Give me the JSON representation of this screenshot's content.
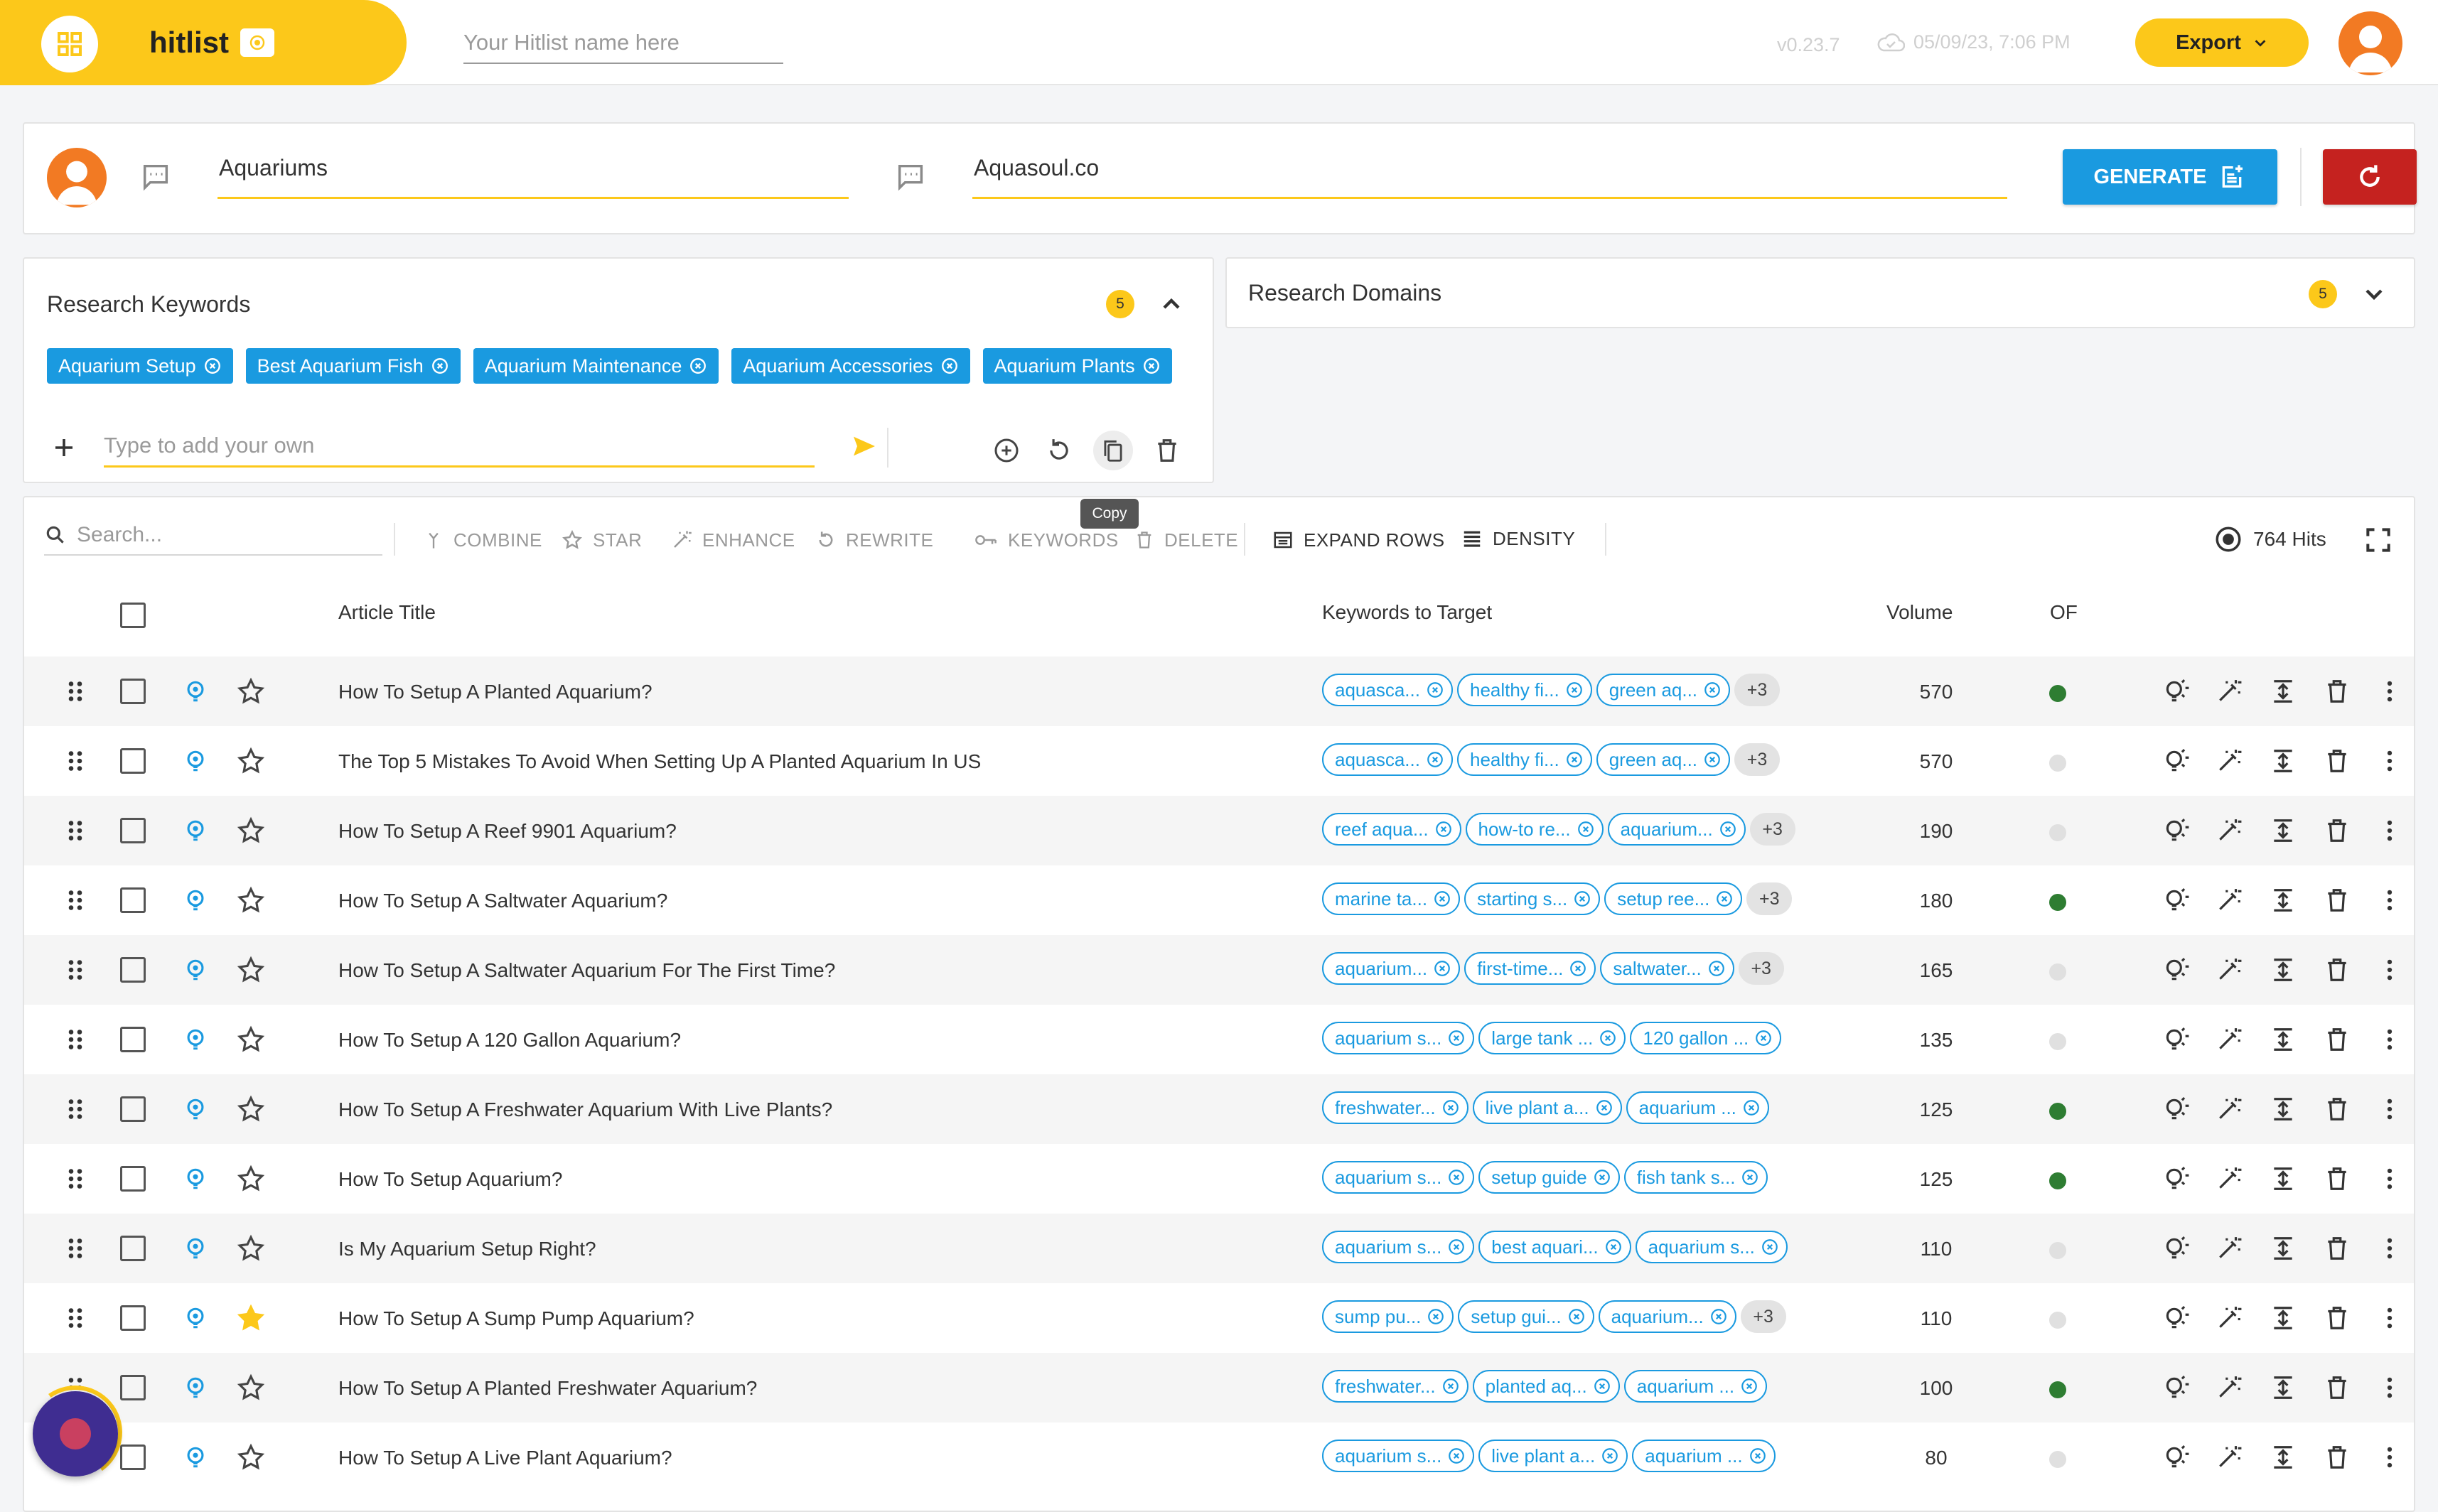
{
  "header": {
    "app_name": "hitlist",
    "name_placeholder": "Your Hitlist name here",
    "version": "v0.23.7",
    "saved_time": "05/09/23, 7:06 PM",
    "export_label": "Export"
  },
  "generator": {
    "topic_value": "Aquariums",
    "domain_value": "Aquasoul.co",
    "generate_label": "GENERATE"
  },
  "research_keywords": {
    "title": "Research Keywords",
    "count": "5",
    "chips": [
      "Aquarium Setup",
      "Best Aquarium Fish",
      "Aquarium Maintenance",
      "Aquarium Accessories",
      "Aquarium Plants"
    ],
    "input_placeholder": "Type to add your own"
  },
  "research_domains": {
    "title": "Research Domains",
    "count": "5"
  },
  "tooltip": "Copy",
  "toolbar": {
    "search_placeholder": "Search...",
    "combine": "COMBINE",
    "star": "STAR",
    "enhance": "ENHANCE",
    "rewrite": "REWRITE",
    "keywords": "KEYWORDS",
    "delete": "DELETE",
    "expand_rows": "EXPAND ROWS",
    "density": "DENSITY",
    "hits": "764 Hits"
  },
  "table": {
    "columns": {
      "title": "Article Title",
      "keywords": "Keywords to Target",
      "volume": "Volume",
      "of": "OF"
    },
    "rows": [
      {
        "title": "How To Setup A Planted Aquarium?",
        "chips": [
          "aquasca...",
          "healthy fi...",
          "green aq..."
        ],
        "more": "+3",
        "volume": "570",
        "of": "green",
        "starred": false
      },
      {
        "title": "The Top 5 Mistakes To Avoid When Setting Up A Planted Aquarium In US",
        "chips": [
          "aquasca...",
          "healthy fi...",
          "green aq..."
        ],
        "more": "+3",
        "volume": "570",
        "of": "grey",
        "starred": false
      },
      {
        "title": "How To Setup A Reef 9901 Aquarium?",
        "chips": [
          "reef aqua...",
          "how-to re...",
          "aquarium..."
        ],
        "more": "+3",
        "volume": "190",
        "of": "grey",
        "starred": false
      },
      {
        "title": "How To Setup A Saltwater Aquarium?",
        "chips": [
          "marine ta...",
          "starting s...",
          "setup ree..."
        ],
        "more": "+3",
        "volume": "180",
        "of": "green",
        "starred": false
      },
      {
        "title": "How To Setup A Saltwater Aquarium For The First Time?",
        "chips": [
          "aquarium...",
          "first-time...",
          "saltwater..."
        ],
        "more": "+3",
        "volume": "165",
        "of": "grey",
        "starred": false
      },
      {
        "title": "How To Setup A 120 Gallon Aquarium?",
        "chips": [
          "aquarium s...",
          "large tank ...",
          "120 gallon ..."
        ],
        "more": "",
        "volume": "135",
        "of": "grey",
        "starred": false
      },
      {
        "title": "How To Setup A Freshwater Aquarium With Live Plants?",
        "chips": [
          "freshwater...",
          "live plant a...",
          "aquarium ..."
        ],
        "more": "",
        "volume": "125",
        "of": "green",
        "starred": false
      },
      {
        "title": "How To Setup Aquarium?",
        "chips": [
          "aquarium s...",
          "setup guide",
          "fish tank s..."
        ],
        "more": "",
        "volume": "125",
        "of": "green",
        "starred": false
      },
      {
        "title": "Is My Aquarium Setup Right?",
        "chips": [
          "aquarium s...",
          "best aquari...",
          "aquarium s..."
        ],
        "more": "",
        "volume": "110",
        "of": "grey",
        "starred": false
      },
      {
        "title": "How To Setup A Sump Pump Aquarium?",
        "chips": [
          "sump pu...",
          "setup gui...",
          "aquarium..."
        ],
        "more": "+3",
        "volume": "110",
        "of": "grey",
        "starred": true
      },
      {
        "title": "How To Setup A Planted Freshwater Aquarium?",
        "chips": [
          "freshwater...",
          "planted aq...",
          "aquarium ..."
        ],
        "more": "",
        "volume": "100",
        "of": "green",
        "starred": false
      },
      {
        "title": "How To Setup A Live Plant Aquarium?",
        "chips": [
          "aquarium s...",
          "live plant a...",
          "aquarium ..."
        ],
        "more": "",
        "volume": "80",
        "of": "grey",
        "starred": false
      }
    ]
  },
  "colors": {
    "brand_yellow": "#fcc81a",
    "primary_blue": "#1a9ae0",
    "danger_red": "#c5221f",
    "status_green": "#2e7d32",
    "status_grey": "#e0e0e0"
  }
}
